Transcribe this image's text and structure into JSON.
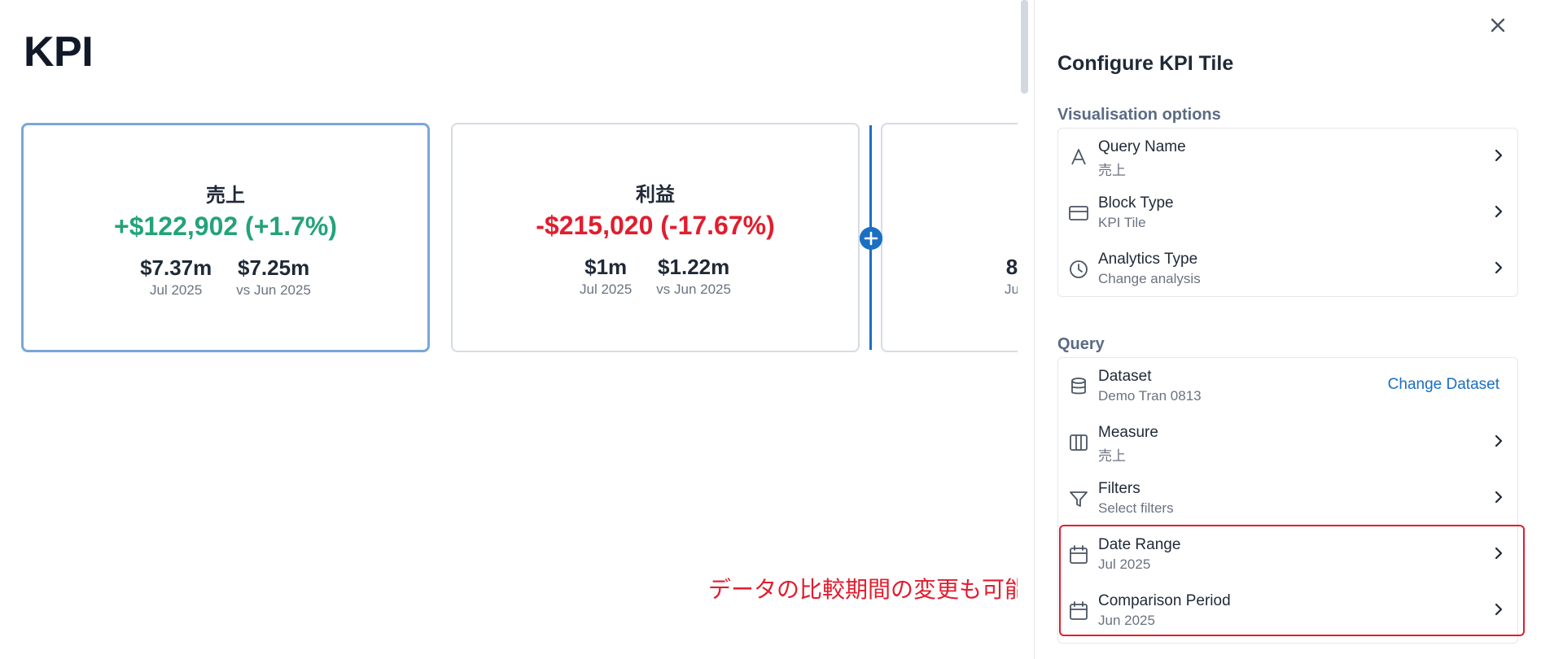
{
  "page": {
    "title": "KPI",
    "annotation": "データの比較期間の変更も可能"
  },
  "tiles": [
    {
      "name": "売上",
      "delta": "+$122,902 (+1.7%)",
      "delta_direction": "positive",
      "current_value": "$7.37m",
      "current_label": "Jul 2025",
      "comparison_value": "$7.25m",
      "comparison_label": "vs Jun 2025",
      "selected": true
    },
    {
      "name": "利益",
      "delta": "-$215,020 (-17.67%)",
      "delta_direction": "negative",
      "current_value": "$1m",
      "current_label": "Jul 2025",
      "comparison_value": "$1.22m",
      "comparison_label": "vs Jun 2025",
      "selected": false
    },
    {
      "name": "",
      "delta": "·",
      "current_value": "8",
      "current_label": "Ju",
      "partial": true
    }
  ],
  "colors": {
    "positive": "#23a37a",
    "negative": "#e11d2e",
    "accent": "#1b6fc2",
    "annotation": "#e11d2e"
  },
  "panel": {
    "title": "Configure KPI Tile",
    "close_icon": "close-icon",
    "visualisation": {
      "title": "Visualisation options",
      "items": [
        {
          "label": "Query Name",
          "value": "売上",
          "icon": "text-a-icon"
        },
        {
          "label": "Block Type",
          "value": "KPI Tile",
          "icon": "card-icon"
        },
        {
          "label": "Analytics Type",
          "value": "Change analysis",
          "icon": "clock-icon"
        }
      ]
    },
    "query": {
      "title": "Query",
      "items": [
        {
          "label": "Dataset",
          "value": "Demo Tran 0813",
          "icon": "database-icon",
          "action": "Change Dataset"
        },
        {
          "label": "Measure",
          "value": "売上",
          "icon": "columns-icon"
        },
        {
          "label": "Filters",
          "value": "Select filters",
          "icon": "filter-icon"
        },
        {
          "label": "Date Range",
          "value": "Jul 2025",
          "icon": "calendar-icon"
        },
        {
          "label": "Comparison Period",
          "value": "Jun 2025",
          "icon": "calendar-icon"
        }
      ]
    }
  }
}
